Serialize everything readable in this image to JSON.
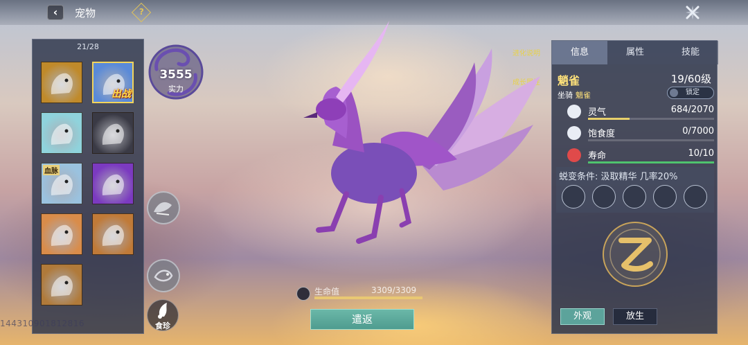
{
  "header": {
    "back_icon": "chevron-left-icon",
    "title": "宠物",
    "help_label": "?",
    "close_icon": "close-icon"
  },
  "pet_list": {
    "count": "21/28",
    "slots": [
      {
        "name": "golden-dragon",
        "tag": "",
        "badge": "",
        "selected": false,
        "color": "#c08a2a"
      },
      {
        "name": "blue-phoenix",
        "tag": "",
        "badge": "出战",
        "selected": true,
        "color": "#5a8ad8"
      },
      {
        "name": "white-fox",
        "tag": "",
        "badge": "",
        "selected": false,
        "color": "#8fd3dc"
      },
      {
        "name": "black-wolf",
        "tag": "",
        "badge": "",
        "selected": false,
        "color": "#3a3a45"
      },
      {
        "name": "ice-dragon",
        "tag": "血脉",
        "badge": "",
        "selected": false,
        "color": "#9ac2df"
      },
      {
        "name": "white-horse",
        "tag": "",
        "badge": "",
        "selected": false,
        "color": "#7b3ac0"
      },
      {
        "name": "snow-fox",
        "tag": "",
        "badge": "",
        "selected": false,
        "color": "#d98c4a"
      },
      {
        "name": "cyan-beast",
        "tag": "",
        "badge": "",
        "selected": false,
        "color": "#c07a38"
      },
      {
        "name": "flower-beast",
        "tag": "",
        "badge": "",
        "selected": false,
        "color": "#b07a3a"
      }
    ]
  },
  "power": {
    "value": "3555",
    "label": "实力"
  },
  "side_actions": {
    "food_label": "食珍"
  },
  "uid": "144310901812816",
  "top_links": {
    "evolve_info": "进化说明",
    "level_info": "成长属性"
  },
  "hp": {
    "label": "生命值",
    "value": "3309/3309",
    "fraction": 1.0
  },
  "return_button": "遣返",
  "info_panel": {
    "tabs": [
      "信息",
      "属性",
      "技能"
    ],
    "active_tab": 0,
    "name": "魈雀",
    "level": "19/60级",
    "mount_label": "坐骑",
    "mount_name": "魈雀",
    "lock_label": "锁定",
    "stats": [
      {
        "label": "灵气",
        "value": "684/2070",
        "fraction": 0.33,
        "color": "#e8d06a",
        "icon": "spirit-icon"
      },
      {
        "label": "饱食度",
        "value": "0/7000",
        "fraction": 0.0,
        "color": "#e8d06a",
        "icon": "hunger-icon"
      },
      {
        "label": "寿命",
        "value": "10/10",
        "fraction": 1.0,
        "color": "#4fc46e",
        "icon": "heart-icon"
      }
    ],
    "evolve_title": "蜕变条件: 汲取精华 几率20%",
    "evolve_slots": [
      "moon-rune-icon",
      "wave-rune-icon",
      "eye-rune-icon",
      "hourglass-rune-icon",
      "leaf-rune-icon"
    ],
    "emblem_icon": "evolution-emblem-icon",
    "look_button": "外观",
    "release_button": "放生"
  }
}
